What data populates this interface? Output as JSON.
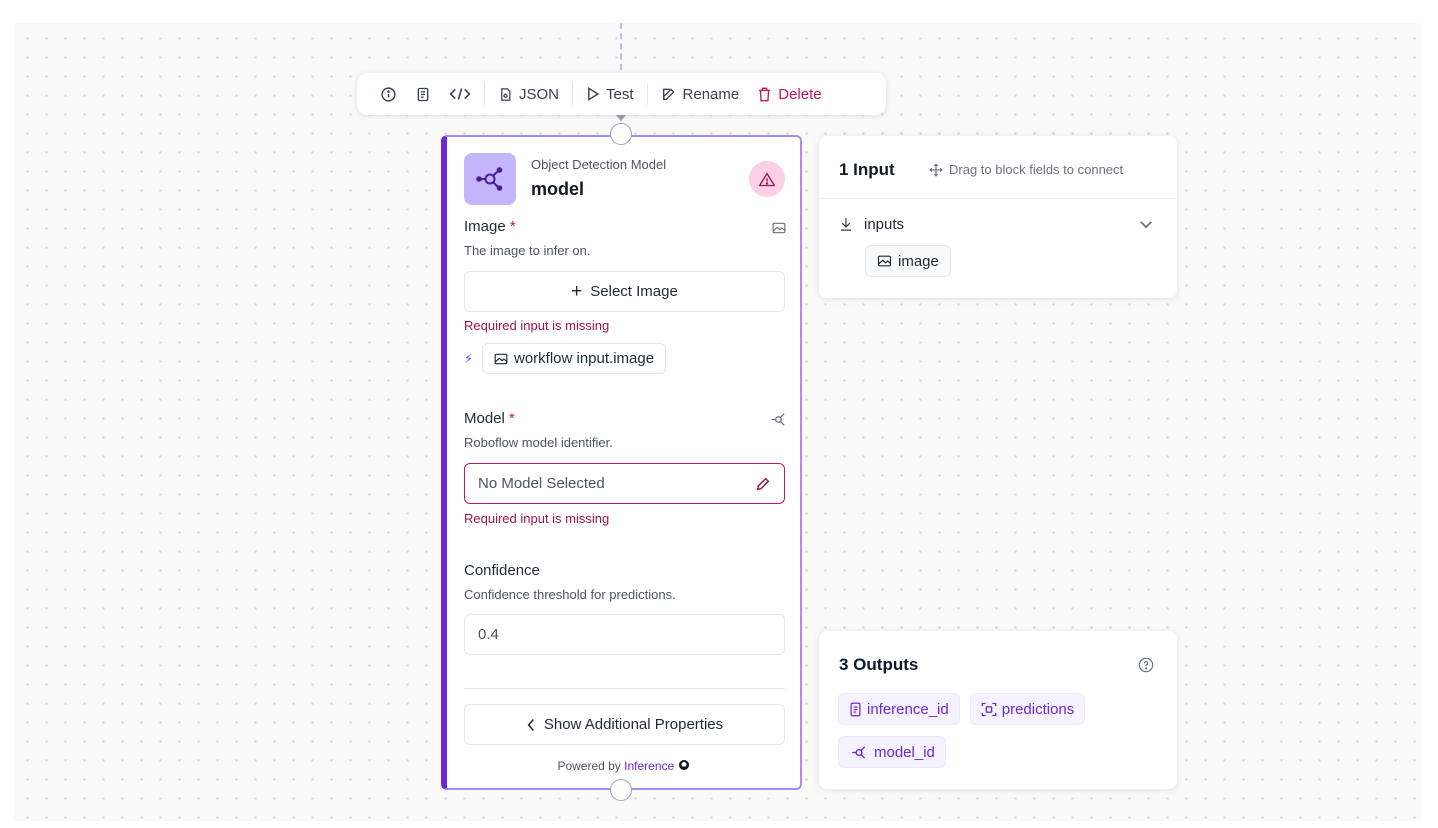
{
  "toolbar": {
    "json_label": "JSON",
    "test_label": "Test",
    "rename_label": "Rename",
    "delete_label": "Delete"
  },
  "node": {
    "kind": "Object Detection Model",
    "name": "model",
    "image_field": {
      "label": "Image",
      "required_mark": "*",
      "description": "The image to infer on.",
      "select_button": "Select Image",
      "error": "Required input is missing",
      "binding": "workflow input.image"
    },
    "model_field": {
      "label": "Model",
      "required_mark": "*",
      "description": "Roboflow model identifier.",
      "value": "No Model Selected",
      "error": "Required input is missing"
    },
    "confidence_field": {
      "label": "Confidence",
      "description": "Confidence threshold for predictions.",
      "value": "0.4"
    },
    "show_more": "Show Additional Properties",
    "powered_by": "Powered by",
    "powered_link": "Inference"
  },
  "inputs_panel": {
    "title": "1 Input",
    "hint": "Drag to block fields to connect",
    "group": "inputs",
    "items": [
      "image"
    ]
  },
  "outputs_panel": {
    "title": "3 Outputs",
    "items": [
      "inference_id",
      "predictions",
      "model_id"
    ]
  },
  "colors": {
    "accent": "#6d28d9",
    "accent_light": "#c4b5fd",
    "error": "#9d174d",
    "warning_bg": "#fbcfe8"
  }
}
